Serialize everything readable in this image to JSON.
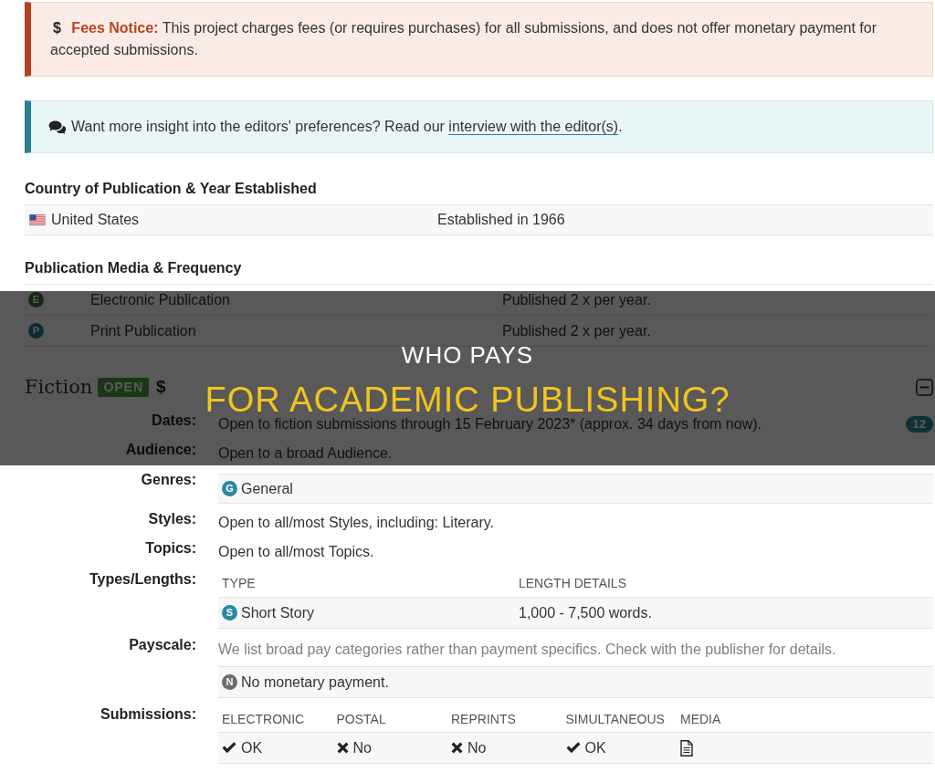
{
  "fees_notice": {
    "text": "**$ Fees Notice:** This project charges fees (or requires purchases) for all submissions, and does not offer monetary payment for accepted submissions."
  },
  "insight_notice": {
    "text_before": "Want more insight into the editors' preferences? Read our ",
    "link": "interview with the editor(s)",
    "text_after": "."
  },
  "country_section": {
    "heading": "Country of Publication & Year Established",
    "country": "United States",
    "established": "Established in 1966"
  },
  "media_section": {
    "heading": "Publication Media & Frequency",
    "rows": [
      {
        "kind": "electronic",
        "letter": "E",
        "medium": "Electronic Publication",
        "frequency": "Published 2 x per year."
      },
      {
        "kind": "print",
        "letter": "P",
        "medium": "Print Publication",
        "frequency": "Published 2 x per year."
      }
    ]
  },
  "fiction": {
    "title": "Fiction",
    "status": "OPEN",
    "fee_symbol": "$",
    "expanded": true,
    "details": [
      {
        "kind": "text",
        "label": "Dates:",
        "text": "Open to fiction submissions through 15 February 2023* (approx. 34 days from now).",
        "count": "12"
      },
      {
        "kind": "text",
        "label": "Audience:",
        "text": "Open to a broad Audience."
      },
      {
        "kind": "tags",
        "label": "Genres:",
        "items": [
          {
            "letter": "G",
            "name": "General"
          }
        ]
      },
      {
        "kind": "text",
        "label": "Styles:",
        "text": "Open to all/most Styles, including: Literary."
      },
      {
        "kind": "text",
        "label": "Topics:",
        "text": "Open to all/most Topics."
      },
      {
        "kind": "table",
        "label": "Types/Lengths:",
        "columns": [
          "TYPE",
          "LENGTH DETAILS"
        ],
        "rows": [
          {
            "letter": "S",
            "type": "Short Story",
            "length": "1,000 - 7,500 words."
          }
        ]
      },
      {
        "kind": "payscale",
        "label": "Payscale:",
        "note": "We list broad pay categories rather than payment specifics. Check with the publisher for details.",
        "items": [
          {
            "letter": "N",
            "name": "No monetary payment."
          }
        ]
      },
      {
        "kind": "submissions",
        "label": "Submissions:",
        "columns": [
          "ELECTRONIC",
          "POSTAL",
          "REPRINTS",
          "SIMULTANEOUS",
          "MEDIA"
        ],
        "cells": [
          {
            "kind": "status",
            "accepted": true,
            "text": "OK"
          },
          {
            "kind": "status",
            "accepted": false,
            "text": "No"
          },
          {
            "kind": "status",
            "accepted": false,
            "text": "No"
          },
          {
            "kind": "status",
            "accepted": true,
            "text": "OK"
          },
          {
            "kind": "document"
          }
        ]
      }
    ]
  },
  "banner": {
    "line_1": "WHO PAYS",
    "line_2": "FOR ACADEMIC PUBLISHING?"
  }
}
